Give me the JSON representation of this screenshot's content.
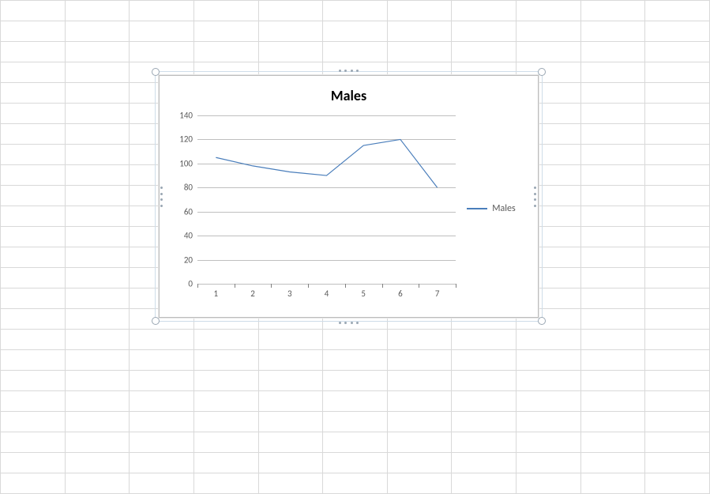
{
  "chart_data": {
    "type": "line",
    "title": "Males",
    "categories": [
      1,
      2,
      3,
      4,
      5,
      6,
      7
    ],
    "series": [
      {
        "name": "Males",
        "values": [
          105,
          98,
          93,
          90,
          115,
          120,
          80
        ],
        "color": "#4a7ebb"
      }
    ],
    "ylim": [
      0,
      140
    ],
    "ystep": 20,
    "xlabel": "",
    "ylabel": "",
    "grid": true,
    "legend_position": "right"
  }
}
